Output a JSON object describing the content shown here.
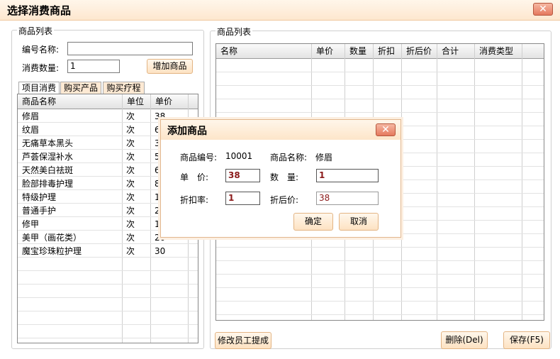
{
  "window": {
    "title": "选择消费商品",
    "close_glyph": "✕"
  },
  "left_group": {
    "legend": "商品列表",
    "code_label": "编号名称:",
    "code_value": "",
    "qty_label": "消费数量:",
    "qty_value": "1",
    "add_button": "增加商品",
    "tabs": [
      "项目消费",
      "购买产品",
      "购买疗程"
    ],
    "columns": [
      "商品名称",
      "单位",
      "单价"
    ],
    "rows": [
      {
        "name": "修眉",
        "unit": "次",
        "price": "38"
      },
      {
        "name": "纹眉",
        "unit": "次",
        "price": "6"
      },
      {
        "name": "无痛草本黑头",
        "unit": "次",
        "price": "3"
      },
      {
        "name": "芦荟保湿补水",
        "unit": "次",
        "price": "5"
      },
      {
        "name": "天然美白祛斑",
        "unit": "次",
        "price": "6"
      },
      {
        "name": "脸部排毒护理",
        "unit": "次",
        "price": "8"
      },
      {
        "name": "特级护理",
        "unit": "次",
        "price": "1"
      },
      {
        "name": "普通手护",
        "unit": "次",
        "price": "2"
      },
      {
        "name": "修甲",
        "unit": "次",
        "price": "1"
      },
      {
        "name": "美甲（画花类）",
        "unit": "次",
        "price": "20"
      },
      {
        "name": "魔宝珍珠粒护理",
        "unit": "次",
        "price": "30"
      }
    ]
  },
  "right_group": {
    "legend": "商品列表",
    "columns": [
      "名称",
      "单价",
      "数量",
      "折扣",
      "折后价",
      "合计",
      "消费类型"
    ],
    "modify_button": "修改员工提成",
    "delete_button": "删除(Del)",
    "save_button": "保存(F5)"
  },
  "dialog": {
    "title": "添加商品",
    "close_glyph": "✕",
    "code_label": "商品编号:",
    "code_value": "10001",
    "name_label": "商品名称:",
    "name_value": "修眉",
    "price_label": "单　价:",
    "price_value": "38",
    "qty_label": "数　量:",
    "qty_value": "1",
    "discount_label": "折扣率:",
    "discount_value": "1",
    "after_label": "折后价:",
    "after_value": "38",
    "ok_button": "确定",
    "cancel_button": "取消"
  },
  "colors": {
    "accent_border": "#e3b483",
    "title_bg": "#fde7cf",
    "close_red": "#e5795e",
    "value_red": "#8b1a1a"
  }
}
